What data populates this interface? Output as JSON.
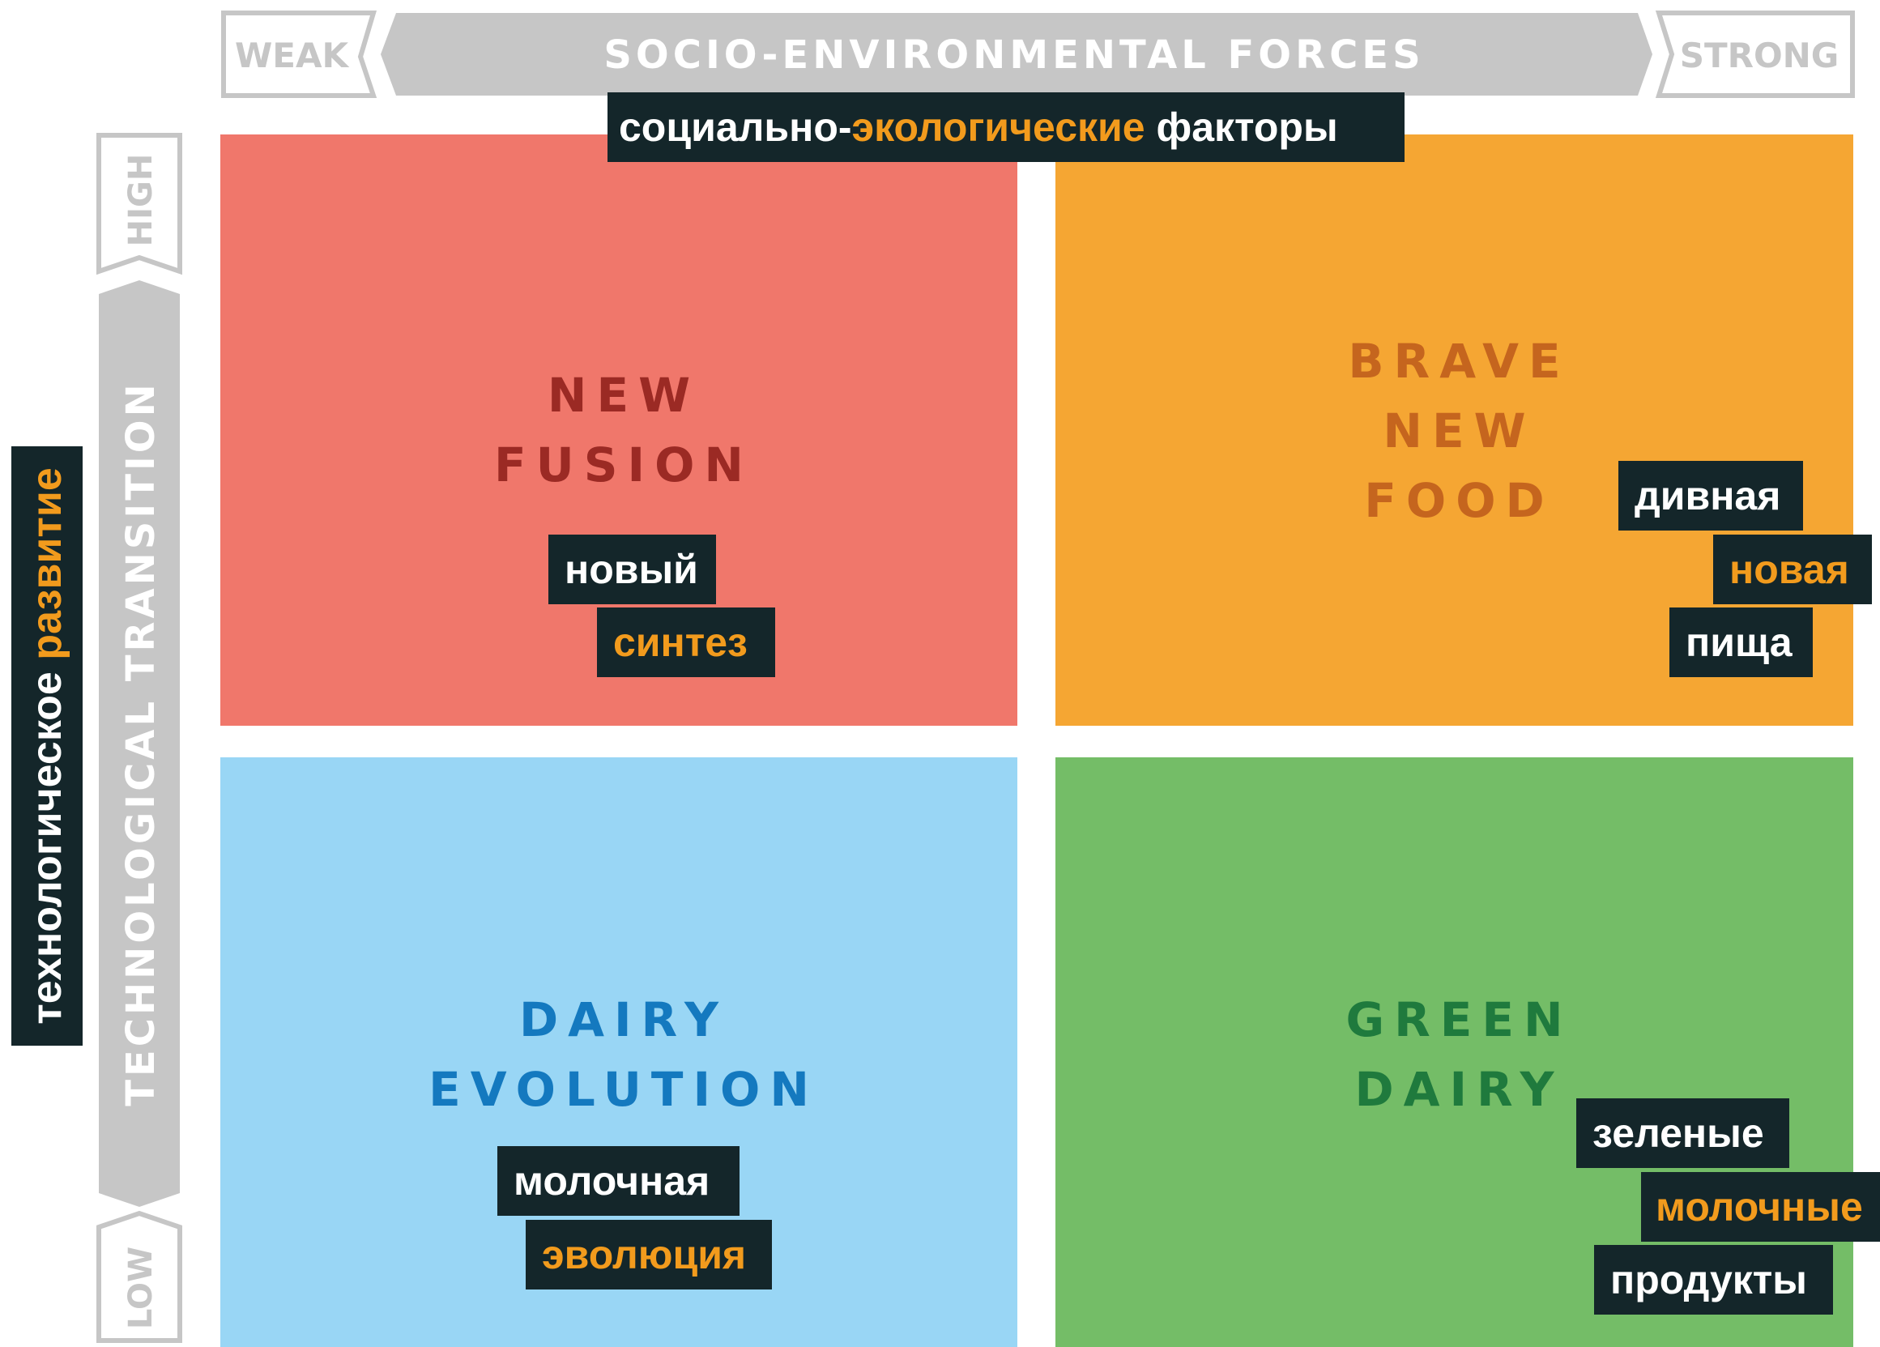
{
  "colors": {
    "axis_gray": "#c6c6c6",
    "tag_bg": "#14262a",
    "accent_orange": "#f29b1d",
    "new_fusion_bg": "#f0776b",
    "new_fusion_text": "#9b2a24",
    "brave_bg": "#f5a633",
    "brave_text": "#c5651e",
    "dairy_evo_bg": "#99d6f5",
    "dairy_evo_text": "#1479bf",
    "green_bg": "#74bd67",
    "green_text": "#1f7a3d"
  },
  "x_axis": {
    "low_label": "WEAK",
    "title": "SOCIO-ENVIRONMENTAL FORCES",
    "high_label": "STRONG",
    "translation": {
      "part1": "социально-",
      "part2": "экологические",
      "part3": " факторы"
    }
  },
  "y_axis": {
    "high_label": "HIGH",
    "title": "TECHNOLOGICAL TRANSITION",
    "low_label": "LOW",
    "translation": {
      "part1": "технологическое ",
      "part2": "развитие"
    }
  },
  "quadrants": {
    "new_fusion": {
      "title_lines": [
        "NEW",
        "FUSION"
      ],
      "tags": [
        "новый",
        "синтез"
      ]
    },
    "brave_new_food": {
      "title_lines": [
        "BRAVE",
        "NEW",
        "FOOD"
      ],
      "tags": [
        "дивная",
        "новая",
        "пища"
      ]
    },
    "dairy_evolution": {
      "title_lines": [
        "DAIRY",
        "EVOLUTION"
      ],
      "tags": [
        "молочная",
        "эволюция"
      ]
    },
    "green_dairy": {
      "title_lines": [
        "GREEN",
        "DAIRY"
      ],
      "tags": [
        "зеленые",
        "молочные",
        "продукты"
      ]
    }
  }
}
